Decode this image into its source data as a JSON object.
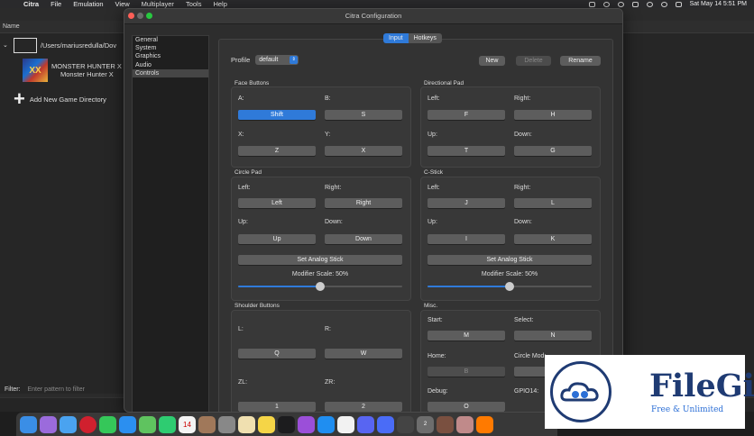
{
  "menubar": {
    "app": "Citra",
    "items": [
      "File",
      "Emulation",
      "View",
      "Multiplayer",
      "Tools",
      "Help"
    ],
    "datetime": "Sat May 14  5:51 PM"
  },
  "gamelist": {
    "column": "Name",
    "folder_path": "/Users/mariusredulla/Dov",
    "game_title": "MONSTER HUNTER X",
    "game_subtitle": "Monster Hunter X",
    "add_dir": "Add New Game Directory"
  },
  "filter": {
    "label": "Filter:",
    "placeholder": "Enter pattern to filter"
  },
  "dialog": {
    "title": "Citra Configuration",
    "sidebar": [
      "General",
      "System",
      "Graphics",
      "Audio",
      "Controls"
    ],
    "selected_sidebar": "Controls",
    "tabs": [
      "Input",
      "Hotkeys"
    ],
    "active_tab": "Input",
    "profile_label": "Profile",
    "profile_value": "default",
    "buttons": {
      "new": "New",
      "delete": "Delete",
      "rename": "Rename"
    },
    "face": {
      "title": "Face Buttons",
      "a_label": "A:",
      "a_value": "Shift",
      "b_label": "B:",
      "b_value": "S",
      "x_label": "X:",
      "x_value": "Z",
      "y_label": "Y:",
      "y_value": "X"
    },
    "dpad": {
      "title": "Directional Pad",
      "left_label": "Left:",
      "left_value": "F",
      "right_label": "Right:",
      "right_value": "H",
      "up_label": "Up:",
      "up_value": "T",
      "down_label": "Down:",
      "down_value": "G"
    },
    "circle": {
      "title": "Circle Pad",
      "left_label": "Left:",
      "left_value": "Left",
      "right_label": "Right:",
      "right_value": "Right",
      "up_label": "Up:",
      "up_value": "Up",
      "down_label": "Down:",
      "down_value": "Down",
      "analog": "Set Analog Stick",
      "modifier": "Modifier Scale: 50%",
      "modifier_value": 0.5
    },
    "cstick": {
      "title": "C-Stick",
      "left_label": "Left:",
      "left_value": "J",
      "right_label": "Right:",
      "right_value": "L",
      "up_label": "Up:",
      "up_value": "I",
      "down_label": "Down:",
      "down_value": "K",
      "analog": "Set Analog Stick",
      "modifier": "Modifier Scale: 50%",
      "modifier_value": 0.5
    },
    "shoulder": {
      "title": "Shoulder Buttons",
      "l_label": "L:",
      "l_value": "Q",
      "r_label": "R:",
      "r_value": "W",
      "zl_label": "ZL:",
      "zl_value": "1",
      "zr_label": "ZR:",
      "zr_value": "2"
    },
    "misc": {
      "title": "Misc.",
      "start_label": "Start:",
      "start_value": "M",
      "select_label": "Select:",
      "select_value": "N",
      "home_label": "Home:",
      "home_value": "B",
      "circlemod_label": "Circle Mod:",
      "debug_label": "Debug:",
      "debug_value": "O",
      "gpio_label": "GPIO14:"
    }
  },
  "dock_badges": {
    "calendar": "14",
    "mail_badge": "2"
  },
  "watermark": {
    "name": "FileGit",
    "tagline": "Free & Unlimited"
  }
}
